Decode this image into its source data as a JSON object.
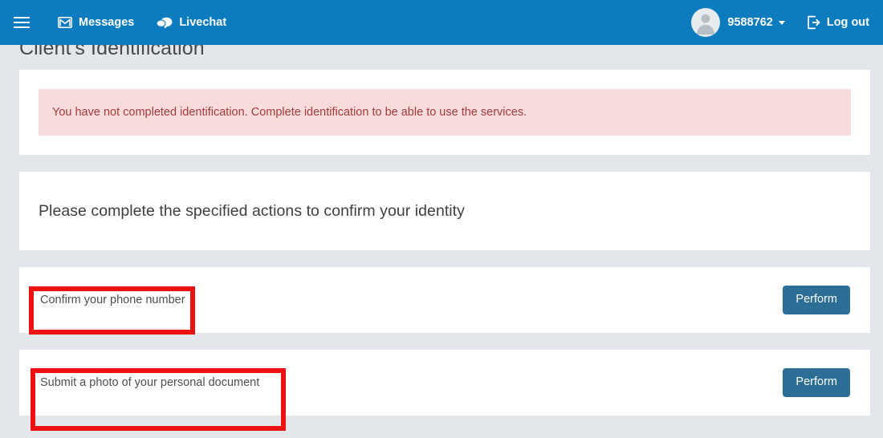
{
  "navbar": {
    "menu_toggle_label": "Menu",
    "messages_label": "Messages",
    "livechat_label": "Livechat",
    "user_id": "9588762",
    "logout_label": "Log out",
    "background_color": "#0d7cbf"
  },
  "page": {
    "title": "Client's Identification",
    "background_color": "#e3e6ea"
  },
  "alert": {
    "text": "You have not completed identification. Complete identification to be able to use the services.",
    "background_color": "#f8dcdc",
    "text_color": "#a33b3b"
  },
  "instruction": {
    "heading": "Please complete the specified actions to confirm your identity"
  },
  "actions": [
    {
      "label": "Confirm your phone number",
      "button_label": "Perform"
    },
    {
      "label": "Submit a photo of your personal document",
      "button_label": "Perform"
    }
  ],
  "button": {
    "color": "#2c6e95"
  },
  "annotations": {
    "highlight_color": "#ee1111",
    "phone_box_label": "Confirm your phone number",
    "document_box_label": "Submit a photo of your personal document"
  }
}
